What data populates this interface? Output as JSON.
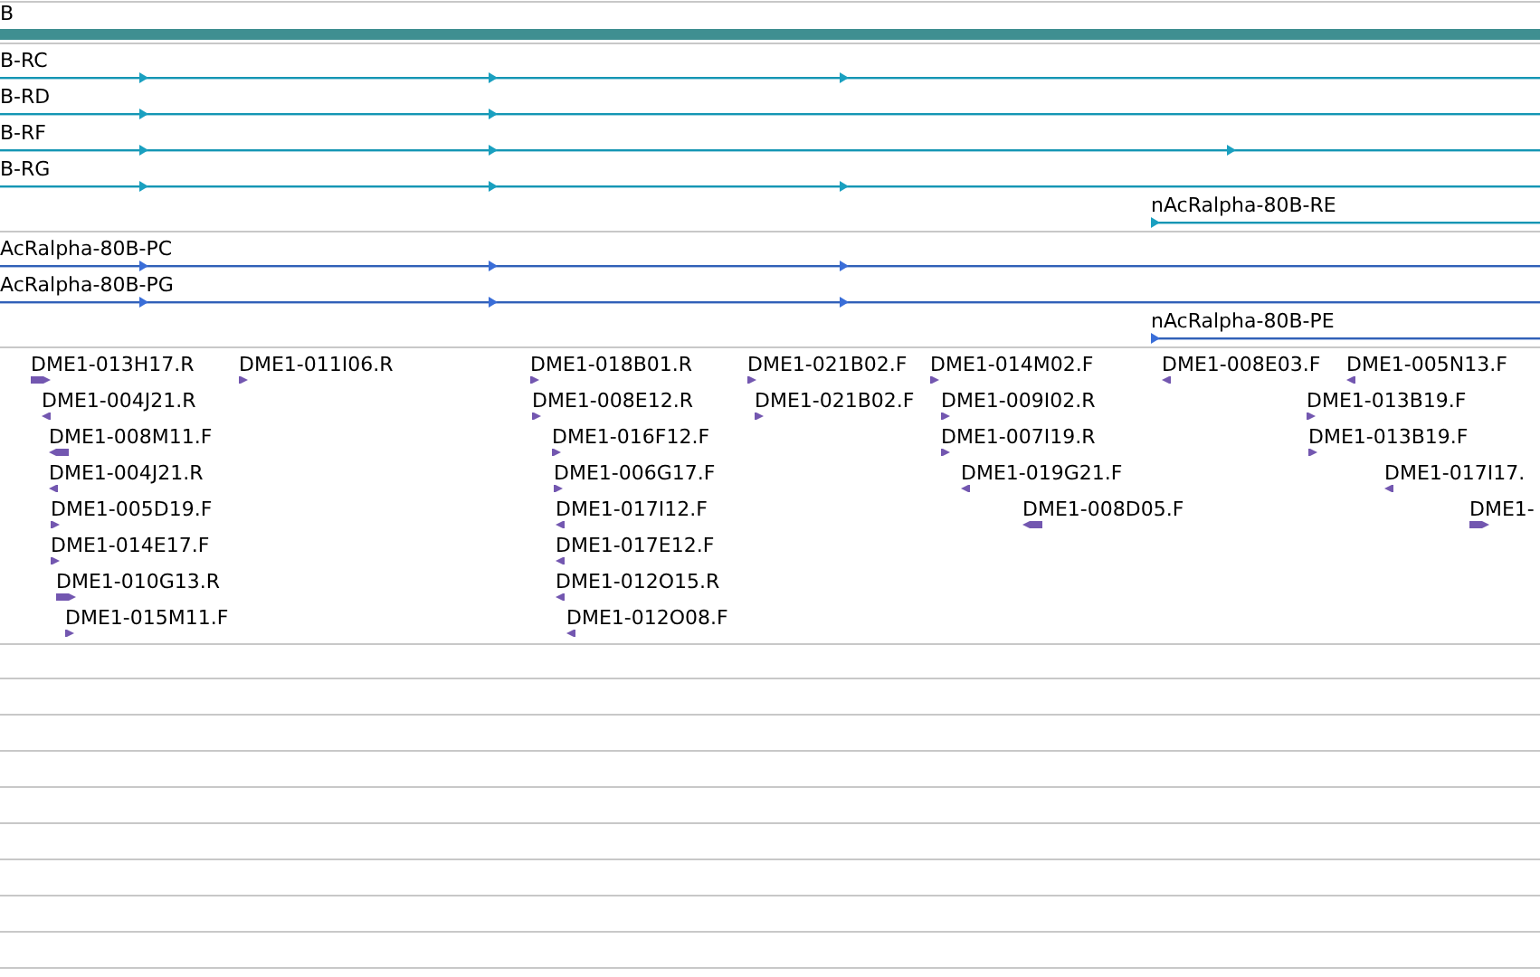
{
  "gene_track": {
    "label": "B"
  },
  "transcript_track": {
    "transcripts": [
      {
        "label": "B-RC"
      },
      {
        "label": "B-RD"
      },
      {
        "label": "B-RF"
      },
      {
        "label": "B-RG"
      },
      {
        "label": "nAcRalpha-80B-RE"
      }
    ]
  },
  "protein_track": {
    "proteins": [
      {
        "label": "AcRalpha-80B-PC"
      },
      {
        "label": "AcRalpha-80B-PG"
      },
      {
        "label": "nAcRalpha-80B-PE"
      }
    ]
  },
  "clone_track": {
    "clones": [
      {
        "label": "DME1-013H17.R",
        "kind": "forward"
      },
      {
        "label": "DME1-011I06.R",
        "kind": "forward"
      },
      {
        "label": "DME1-018B01.R",
        "kind": "forward"
      },
      {
        "label": "DME1-021B02.F",
        "kind": "forward"
      },
      {
        "label": "DME1-014M02.F",
        "kind": "forward"
      },
      {
        "label": "DME1-008E03.F",
        "kind": "reverse"
      },
      {
        "label": "DME1-005N13.F",
        "kind": "reverse"
      },
      {
        "label": "DME1-004J21.R",
        "kind": "reverse"
      },
      {
        "label": "DME1-008E12.R",
        "kind": "forward"
      },
      {
        "label": "DME1-021B02.F",
        "kind": "forward"
      },
      {
        "label": "DME1-009I02.R",
        "kind": "forward"
      },
      {
        "label": "DME1-013B19.F",
        "kind": "forward"
      },
      {
        "label": "DME1-008M11.F",
        "kind": "reverse"
      },
      {
        "label": "DME1-016F12.F",
        "kind": "forward"
      },
      {
        "label": "DME1-007I19.R",
        "kind": "forward"
      },
      {
        "label": "DME1-013B19.F",
        "kind": "forward"
      },
      {
        "label": "DME1-004J21.R",
        "kind": "reverse"
      },
      {
        "label": "DME1-006G17.F",
        "kind": "forward"
      },
      {
        "label": "DME1-019G21.F",
        "kind": "reverse"
      },
      {
        "label": "DME1-017I17.",
        "kind": "reverse"
      },
      {
        "label": "DME1-005D19.F",
        "kind": "forward"
      },
      {
        "label": "DME1-017I12.F",
        "kind": "reverse"
      },
      {
        "label": "DME1-008D05.F",
        "kind": "reverse"
      },
      {
        "label": "DME1-",
        "kind": "forward"
      },
      {
        "label": "DME1-014E17.F",
        "kind": "forward"
      },
      {
        "label": "DME1-017E12.F",
        "kind": "reverse"
      },
      {
        "label": "DME1-010G13.R",
        "kind": "forward"
      },
      {
        "label": "DME1-012O15.R",
        "kind": "reverse"
      },
      {
        "label": "DME1-015M11.F",
        "kind": "forward"
      },
      {
        "label": "DME1-012O08.F",
        "kind": "reverse"
      }
    ]
  }
}
